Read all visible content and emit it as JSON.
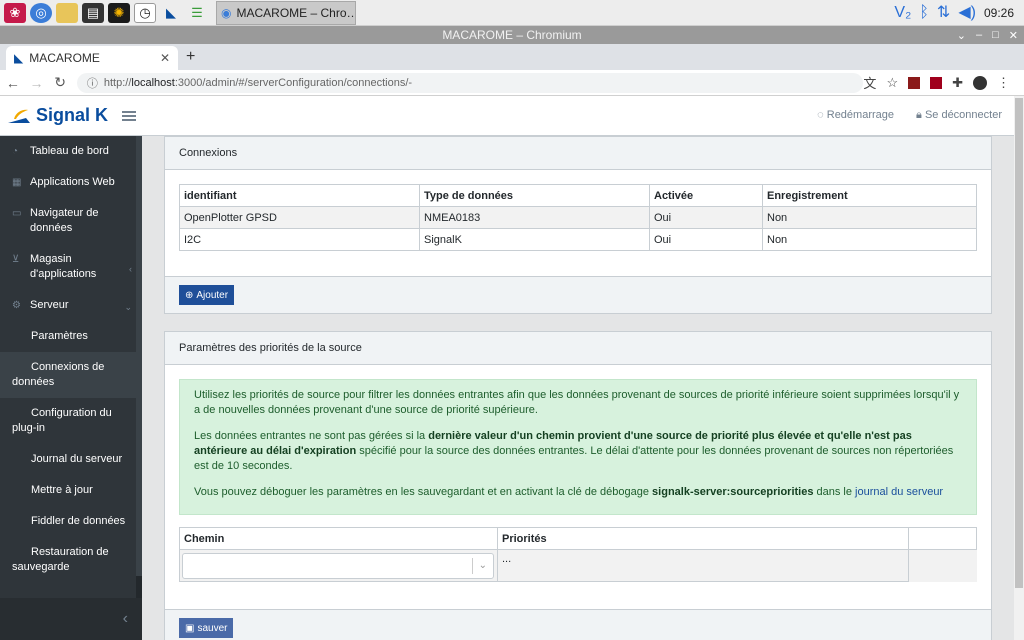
{
  "taskbar": {
    "task_title": "MACAROME – Chro…",
    "clock": "09:26",
    "icons": [
      "raspberry-icon",
      "globe-icon",
      "folder-icon",
      "terminal-icon",
      "sun-icon",
      "clock-icon",
      "signalk-icon",
      "settings-icon"
    ]
  },
  "window": {
    "title": "MACAROME – Chromium"
  },
  "browser": {
    "tab_title": "MACAROME",
    "url_prefix": "http://",
    "url_host": "localhost",
    "url_rest": ":3000/admin/#/serverConfiguration/connections/-"
  },
  "header": {
    "brand": "Signal K",
    "restart": "Redémarrage",
    "logout": "Se déconnecter"
  },
  "sidebar": {
    "items": [
      {
        "label": "Tableau de bord"
      },
      {
        "label": "Applications Web"
      },
      {
        "label": "Navigateur de données"
      },
      {
        "label": "Magasin d'applications"
      },
      {
        "label": "Serveur"
      },
      {
        "label": "Paramètres"
      },
      {
        "label": "Connexions de données"
      },
      {
        "label": "Configuration du plug-in"
      },
      {
        "label": "Journal du serveur"
      },
      {
        "label": "Mettre à jour"
      },
      {
        "label": "Fiddler de données"
      },
      {
        "label": "Restauration de sauvegarde"
      }
    ]
  },
  "connections": {
    "title": "Connexions",
    "columns": [
      "identifiant",
      "Type de données",
      "Activée",
      "Enregistrement"
    ],
    "rows": [
      [
        "OpenPlotter GPSD",
        "NMEA0183",
        "Oui",
        "Non"
      ],
      [
        "I2C",
        "SignalK",
        "Oui",
        "Non"
      ]
    ],
    "add_button": "Ajouter"
  },
  "priorities": {
    "title": "Paramètres des priorités de la source",
    "para1": "Utilisez les priorités de source pour filtrer les données entrantes afin que les données provenant de sources de priorité inférieure soient supprimées lorsqu'il y a de nouvelles données provenant d'une source de priorité supérieure.",
    "para2_a": "Les données entrantes ne sont pas gérées si la ",
    "para2_b": "dernière valeur d'un chemin provient d'une source de priorité plus élevée et qu'elle n'est pas antérieure au délai d'expiration",
    "para2_c": " spécifié pour la source des données entrantes. Le délai d'attente pour les données provenant de sources non répertoriées est de 10 secondes.",
    "para3_a": "Vous pouvez déboguer les paramètres en les sauvegardant et en activant la clé de débogage ",
    "para3_b": "signalk-server:sourcepriorities",
    "para3_c": " dans le ",
    "para3_link": "journal du serveur",
    "col_path": "Chemin",
    "col_priorities": "Priorités",
    "priorities_value": "...",
    "save_button": "sauver"
  }
}
